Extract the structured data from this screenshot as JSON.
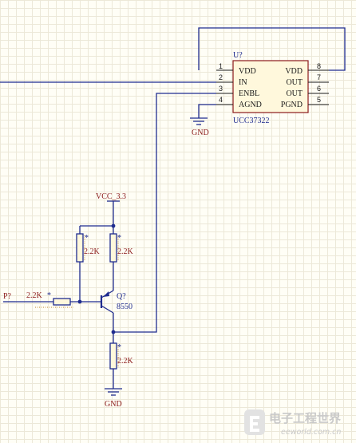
{
  "ic": {
    "ref": "U?",
    "part": "UCC37322",
    "left_pins": [
      {
        "num": "1",
        "name": "VDD"
      },
      {
        "num": "2",
        "name": "IN"
      },
      {
        "num": "3",
        "name": "ENBL"
      },
      {
        "num": "4",
        "name": "AGND"
      }
    ],
    "right_pins": [
      {
        "num": "8",
        "name": "VDD"
      },
      {
        "num": "7",
        "name": "OUT"
      },
      {
        "num": "6",
        "name": "OUT"
      },
      {
        "num": "5",
        "name": "PGND"
      }
    ]
  },
  "power": {
    "vcc_label": "VCC_3.3",
    "gnd_top": "GND",
    "gnd_bottom": "GND"
  },
  "resistors": {
    "r_left": {
      "value": "2.2K",
      "marker": "*"
    },
    "r_mid": {
      "value": "2.2K",
      "marker": "*"
    },
    "r_base": {
      "value": "2.2K",
      "marker": "*"
    },
    "r_emitter": {
      "value": "2.2K",
      "marker": "*"
    }
  },
  "transistor": {
    "ref": "Q?",
    "part": "8550"
  },
  "port": {
    "label": "P?"
  },
  "watermark": {
    "cn": "电子工程世界",
    "en": "eeworld.com.cn"
  }
}
